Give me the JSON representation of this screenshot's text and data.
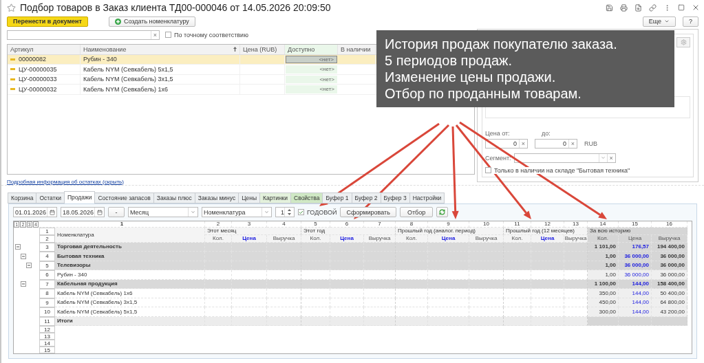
{
  "window": {
    "title": "Подбор товаров в Заказ клиента ТД00-000046 от 14.05.2026 20:09:50"
  },
  "toolbar": {
    "buttons": [
      {
        "label": "Перенести в документ",
        "kind": "primary"
      },
      {
        "label": "Создать номенклатуру",
        "kind": "create"
      }
    ],
    "more": "Еще",
    "help": "?"
  },
  "search": {
    "clear": "×",
    "exact_match": {
      "label": "По точному соответствию",
      "checked": false
    }
  },
  "products": {
    "columns": [
      {
        "label": "Артикул",
        "sorted": false
      },
      {
        "label": "Наименование",
        "sorted": true
      },
      {
        "label": "Цена (RUB)",
        "sorted": false
      },
      {
        "label": "Доступно",
        "sorted": false
      },
      {
        "label": "В наличии",
        "sorted": false
      }
    ],
    "rows": [
      {
        "code": "00000082",
        "name": "Рубин - 340",
        "available": "<нет>",
        "selected": true
      },
      {
        "code": "ЦУ-00000035",
        "name": "Кабель NYM (Севкабель) 5х1,5",
        "available": "<нет>",
        "selected": false
      },
      {
        "code": "ЦУ-00000033",
        "name": "Кабель NYM (Севкабель) 3х1,5",
        "available": "<нет>",
        "selected": false
      },
      {
        "code": "ЦУ-00000032",
        "name": "Кабель NYM (Севкабель) 1х6",
        "available": "<нет>",
        "selected": false
      }
    ]
  },
  "stock_link": "Подробная информация об остатках (скрыть)",
  "filter_panel": {
    "price_from_label": "Цена от:",
    "price_to_label": "до:",
    "price_from": "0",
    "price_to": "0",
    "clear": "×",
    "currency": "RUB",
    "segment_label": "Сегмент:",
    "in_stock": {
      "label": "Только в наличии на складе \"Бытовая техника\"",
      "checked": false
    }
  },
  "tabs": [
    {
      "label": "Корзина",
      "selected": false,
      "color": "#eceff1"
    },
    {
      "label": "Остатки",
      "selected": false,
      "color": "#eceff1"
    },
    {
      "label": "Продажи",
      "selected": true,
      "color": "#ffffff"
    },
    {
      "label": "Состояние запасов",
      "selected": false,
      "color": "#eceff1"
    },
    {
      "label": "Заказы плюс",
      "selected": false,
      "color": "#eceff1"
    },
    {
      "label": "Заказы минус",
      "selected": false,
      "color": "#eceff1"
    },
    {
      "label": "Цены",
      "selected": false,
      "color": "#eceff1"
    },
    {
      "label": "Картинки",
      "selected": false,
      "color": "#e3f1dc"
    },
    {
      "label": "Свойства",
      "selected": false,
      "color": "#cfe8c4"
    },
    {
      "label": "Буфер 1",
      "selected": false,
      "color": "#eceff1"
    },
    {
      "label": "Буфер 2",
      "selected": false,
      "color": "#eceff1"
    },
    {
      "label": "Буфер 3",
      "selected": false,
      "color": "#eceff1"
    },
    {
      "label": "Настройки",
      "selected": false,
      "color": "#eceff1"
    }
  ],
  "report_controls": {
    "date_from": "01.01.2026",
    "date_to": "18.05.2026",
    "dash": "-",
    "period": "Месяц",
    "grouping": "Номенклатура",
    "count": "1",
    "yearly": {
      "label": "ГОДОВОЙ",
      "checked": true
    },
    "generate": "Сформировать",
    "filter": "Отбор"
  },
  "report": {
    "levels": [
      "1",
      "2",
      "3",
      "4"
    ],
    "column_numbers": [
      "1",
      "2",
      "3",
      "4",
      "5",
      "6",
      "7",
      "8",
      "9",
      "10",
      "11",
      "12",
      "13",
      "14",
      "15",
      "16"
    ],
    "header_rows": [
      "1",
      "2"
    ],
    "name_header": "Номенклатура",
    "periods": [
      {
        "title": "Этот месяц",
        "columns": [
          "Кол.",
          "Цена",
          "Выручка"
        ],
        "highlighted": false
      },
      {
        "title": "Этот год",
        "columns": [
          "Кол.",
          "Цена",
          "Выручка"
        ],
        "highlighted": false
      },
      {
        "title": "Прошлый год (аналог. период)",
        "columns": [
          "Кол.",
          "Цена",
          "Выручка"
        ],
        "highlighted": false
      },
      {
        "title": "Прошлый год (12 месяцев)",
        "columns": [
          "Кол.",
          "Цена",
          "Выручка"
        ],
        "highlighted": false
      },
      {
        "title": "За всю историю",
        "columns": [
          "Кол.",
          "Цена",
          "Выручка"
        ],
        "highlighted": true
      }
    ],
    "rows": [
      {
        "num": "3",
        "name": "Торговая деятельность",
        "kind": "group",
        "expanded": true,
        "history": [
          "1 101,00",
          "176,57",
          "194 400,00"
        ],
        "children": [
          {
            "num": "4",
            "name": "Бытовая техника",
            "kind": "group",
            "expanded": true,
            "history": [
              "1,00",
              "36 000,00",
              "36 000,00"
            ],
            "children": [
              {
                "num": "5",
                "name": "Телевизоры",
                "kind": "group",
                "expanded": true,
                "history": [
                  "1,00",
                  "36 000,00",
                  "36 000,00"
                ],
                "children": [
                  {
                    "num": "6",
                    "name": "Рубин - 340",
                    "kind": "item",
                    "history": [
                      "1,00",
                      "36 000,00",
                      "36 000,00"
                    ]
                  }
                ]
              }
            ]
          },
          {
            "num": "7",
            "name": "Кабельная продукция",
            "kind": "group",
            "expanded": true,
            "history": [
              "1 100,00",
              "144,00",
              "158 400,00"
            ],
            "children": [
              {
                "num": "8",
                "name": "Кабель NYM (Севкабель) 1х6",
                "kind": "item",
                "history": [
                  "350,00",
                  "144,00",
                  "50 400,00"
                ]
              },
              {
                "num": "9",
                "name": "Кабель NYM (Севкабель) 3х1,5",
                "kind": "item",
                "history": [
                  "450,00",
                  "144,00",
                  "64 800,00"
                ]
              },
              {
                "num": "10",
                "name": "Кабель NYM (Севкабель) 5х1,5",
                "kind": "item",
                "history": [
                  "300,00",
                  "144,00",
                  "43 200,00"
                ]
              }
            ]
          }
        ]
      },
      {
        "num": "11",
        "name": "Итоги",
        "kind": "total"
      }
    ],
    "empty_rows": [
      "12",
      "13",
      "14",
      "15"
    ]
  },
  "overlay": {
    "lines": [
      "История продаж покупателю заказа.",
      "5 периодов продаж.",
      "Изменение цены продажи.",
      "Отбор по проданным товарам."
    ]
  }
}
